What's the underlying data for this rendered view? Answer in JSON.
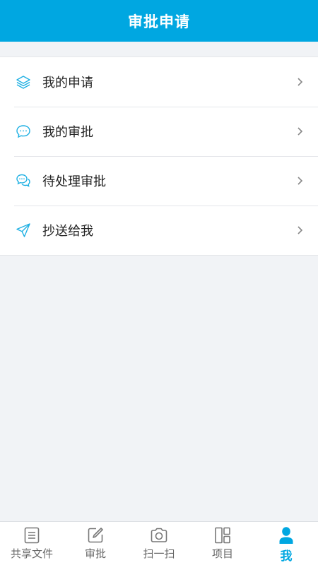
{
  "header": {
    "title": "审批申请"
  },
  "menu": {
    "items": [
      {
        "label": "我的申请",
        "icon": "layers-icon"
      },
      {
        "label": "我的审批",
        "icon": "chat-bubble-icon"
      },
      {
        "label": "待处理审批",
        "icon": "chat-bubbles-icon"
      },
      {
        "label": "抄送给我",
        "icon": "send-icon"
      }
    ]
  },
  "tabbar": {
    "tabs": [
      {
        "label": "共享文件",
        "icon": "document-icon",
        "active": false
      },
      {
        "label": "审批",
        "icon": "edit-icon",
        "active": false
      },
      {
        "label": "扫一扫",
        "icon": "camera-icon",
        "active": false
      },
      {
        "label": "项目",
        "icon": "grid-icon",
        "active": false
      },
      {
        "label": "我",
        "icon": "user-icon",
        "active": true
      }
    ]
  },
  "colors": {
    "accent": "#00a7e1",
    "background": "#f1f3f6"
  }
}
